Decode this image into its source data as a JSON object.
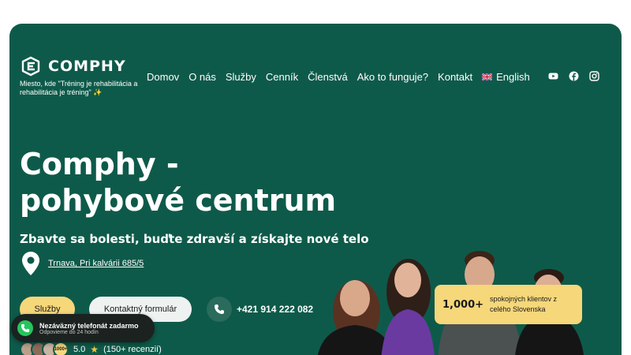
{
  "brand": {
    "name": "COMPHY",
    "tagline": "Miesto, kde \"Tréning je rehabilitácia a rehabilitácia je tréning\" ✨"
  },
  "nav": {
    "items": [
      "Domov",
      "O nás",
      "Služby",
      "Cenník",
      "Členstvá",
      "Ako to funguje?",
      "Kontakt"
    ],
    "language": "English"
  },
  "social": [
    "youtube-icon",
    "facebook-icon",
    "instagram-icon"
  ],
  "hero": {
    "title": "Comphy - pohybové centrum",
    "subtitle": "Zbavte sa bolesti, buďte zdravší a získajte nové telo",
    "address": "Trnava, Pri kalvárii 685/5",
    "primary_button": "Služby",
    "secondary_button": "Kontaktný formulár",
    "phone": "+421 914 222 082"
  },
  "rating": {
    "avatar_badge": "1000+",
    "score": "5.0",
    "reviews": "(150+ recenzií)"
  },
  "stat": {
    "number": "1,000+",
    "label": "spokojných klientov z celého Slovenska"
  },
  "callout": {
    "title": "Nezáväzný telefonát zadarmo",
    "subtitle": "Odpovieme do 24 hodín"
  },
  "colors": {
    "background": "#0e5a4a",
    "accent": "#f6d77a",
    "callout_bg": "#1b2220",
    "whatsapp": "#25c55e"
  }
}
